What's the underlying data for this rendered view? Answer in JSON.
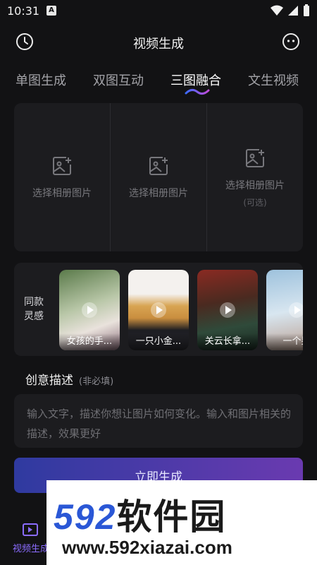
{
  "status_bar": {
    "time": "10:31",
    "a_badge": "A"
  },
  "header": {
    "title": "视频生成",
    "left_icon": "clock-icon",
    "right_icon": "smiley-icon"
  },
  "tabs": [
    "单图生成",
    "双图互动",
    "三图融合",
    "文生视频"
  ],
  "active_tab": 2,
  "upload": {
    "slots": [
      {
        "label": "选择相册图片"
      },
      {
        "label": "选择相册图片"
      },
      {
        "label": "选择相册图片",
        "optional": "(可选)"
      }
    ]
  },
  "inspiration": {
    "label": "同款灵感",
    "cards": [
      {
        "caption": "女孩的手..."
      },
      {
        "caption": "一只小金..."
      },
      {
        "caption": "关云长拿..."
      },
      {
        "caption": "一个男"
      }
    ]
  },
  "description": {
    "title": "创意描述",
    "optional": "(非必填)",
    "placeholder": "输入文字，描述你想让图片如何变化。输入和图片相关的描述，效果更好"
  },
  "generate_button": "立即生成",
  "bottom_nav": {
    "label": "视频生成"
  },
  "watermark": {
    "top_num": "592",
    "top_cn": "软件园",
    "bottom": "www.592xiazai.com"
  },
  "colors": {
    "background": "#121214",
    "accent": "#8b6cff",
    "panel": "#1c1c1f"
  }
}
